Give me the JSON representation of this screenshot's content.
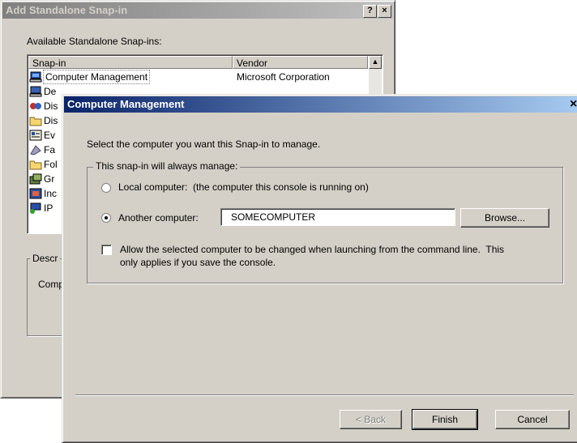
{
  "background_window": {
    "title": "Add Standalone Snap-in",
    "help_button": "?",
    "close_button": "×",
    "available_label": "Available Standalone Snap-ins:",
    "columns": [
      "Snap-in",
      "Vendor"
    ],
    "rows": [
      {
        "name": "Computer Management",
        "vendor": "Microsoft Corporation",
        "icon": "computer-icon"
      },
      {
        "name": "De",
        "icon": "device-icon"
      },
      {
        "name": "Dis",
        "icon": "disk-icon"
      },
      {
        "name": "Dis",
        "icon": "folder-icon"
      },
      {
        "name": "Ev",
        "icon": "event-viewer-icon"
      },
      {
        "name": "Fa",
        "icon": "fax-icon"
      },
      {
        "name": "Fol",
        "icon": "folder-icon"
      },
      {
        "name": "Gr",
        "icon": "group-policy-icon"
      },
      {
        "name": "Inc",
        "icon": "indexing-icon"
      },
      {
        "name": "IP",
        "icon": "ip-security-icon"
      }
    ],
    "description_label": "Descr",
    "description_text": "Comp",
    "scroll_up": "▲"
  },
  "dialog": {
    "title": "Computer Management",
    "close_button": "×",
    "prompt": "Select the computer you want this Snap-in to manage.",
    "group_label": "This snap-in will always manage:",
    "local_option": "Local computer:  (the computer this console is running on)",
    "another_option": "Another computer:",
    "computer_name": "SOMECOMPUTER",
    "browse": "Browse...",
    "allow_change_line1": "Allow the selected computer to be changed when launching from the command line.  This",
    "allow_change_line2": "only applies if you save the console.",
    "selected_option": "another",
    "allow_change_checked": false,
    "back": "< Back",
    "finish": "Finish",
    "cancel": "Cancel"
  }
}
